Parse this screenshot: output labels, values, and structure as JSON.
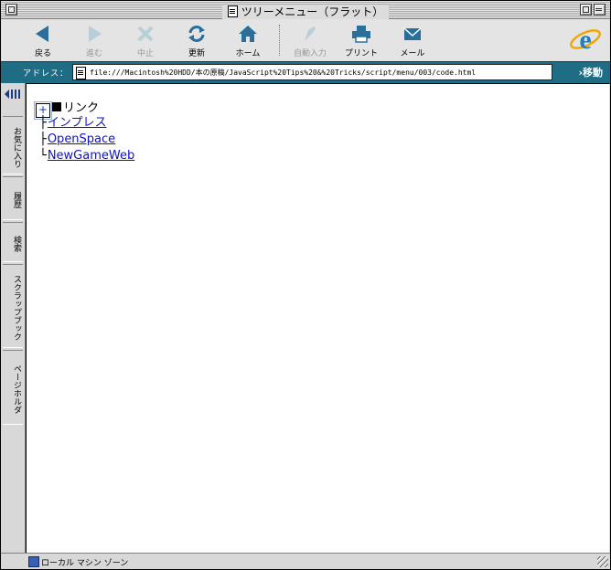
{
  "window": {
    "title": "ツリーメニュー（フラット）"
  },
  "toolbar": {
    "buttons": [
      {
        "label": "戻る",
        "icon": "back-arrow-icon",
        "enabled": true
      },
      {
        "label": "進む",
        "icon": "forward-arrow-icon",
        "enabled": false
      },
      {
        "label": "中止",
        "icon": "stop-x-icon",
        "enabled": false
      },
      {
        "label": "更新",
        "icon": "refresh-icon",
        "enabled": true
      },
      {
        "label": "ホーム",
        "icon": "home-icon",
        "enabled": true
      },
      {
        "label": "自動入力",
        "icon": "autofill-icon",
        "enabled": false
      },
      {
        "label": "プリント",
        "icon": "printer-icon",
        "enabled": true
      },
      {
        "label": "メール",
        "icon": "mail-icon",
        "enabled": true
      }
    ]
  },
  "address": {
    "label": "アドレス：",
    "url": "file:///Macintosh%20HDD/本の原稿/JavaScript%20Tips%20&%20Tricks/script/menu/003/code.html",
    "go_label": "移動"
  },
  "explorer": {
    "tabs": [
      "お気に入り",
      "履歴",
      "検索",
      "スクラップブック",
      "ページホルダ"
    ]
  },
  "content": {
    "toggle": "+",
    "root_label": "リンク",
    "items": [
      {
        "branch": "├",
        "label": "インプレス"
      },
      {
        "branch": "├",
        "label": "OpenSpace"
      },
      {
        "branch": "└",
        "label": "NewGameWeb"
      }
    ]
  },
  "status": {
    "text": "ローカル マシン ゾーン"
  },
  "colors": {
    "address_bar": "#1f6d85",
    "toolbar_icon": "#2a6f9a",
    "link": "#1010cc"
  }
}
